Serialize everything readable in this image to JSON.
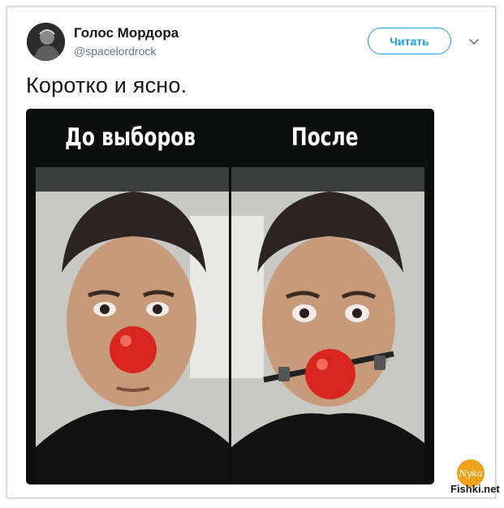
{
  "tweet": {
    "display_name": "Голос Мордора",
    "handle": "@spacelordrock",
    "follow_label": "Читать",
    "text": "Коротко и ясно."
  },
  "media": {
    "label_left": "До выборов",
    "label_right": "После"
  },
  "watermark": {
    "site": "Fishki.net",
    "logo_text": "Nyka"
  },
  "colors": {
    "accent": "#1da1f2",
    "nose": "#d8261f",
    "text": "#14171a",
    "muted": "#657786"
  },
  "icons": {
    "menu": "chevron-down-icon"
  }
}
